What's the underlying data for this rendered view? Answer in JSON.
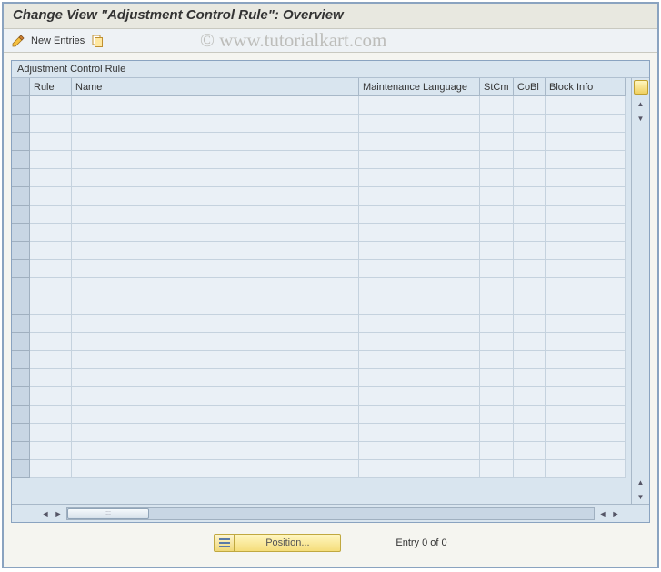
{
  "header": {
    "title": "Change View \"Adjustment Control Rule\": Overview"
  },
  "toolbar": {
    "new_entries_label": "New Entries"
  },
  "grid": {
    "title": "Adjustment Control Rule",
    "columns": {
      "rule": "Rule",
      "name": "Name",
      "lang": "Maintenance Language",
      "stcm": "StCm",
      "cobl": "CoBl",
      "block": "Block Info"
    },
    "rows": [
      {
        "rule": "",
        "name": "",
        "lang": "",
        "stcm": "",
        "cobl": "",
        "block": ""
      },
      {
        "rule": "",
        "name": "",
        "lang": "",
        "stcm": "",
        "cobl": "",
        "block": ""
      },
      {
        "rule": "",
        "name": "",
        "lang": "",
        "stcm": "",
        "cobl": "",
        "block": ""
      },
      {
        "rule": "",
        "name": "",
        "lang": "",
        "stcm": "",
        "cobl": "",
        "block": ""
      },
      {
        "rule": "",
        "name": "",
        "lang": "",
        "stcm": "",
        "cobl": "",
        "block": ""
      },
      {
        "rule": "",
        "name": "",
        "lang": "",
        "stcm": "",
        "cobl": "",
        "block": ""
      },
      {
        "rule": "",
        "name": "",
        "lang": "",
        "stcm": "",
        "cobl": "",
        "block": ""
      },
      {
        "rule": "",
        "name": "",
        "lang": "",
        "stcm": "",
        "cobl": "",
        "block": ""
      },
      {
        "rule": "",
        "name": "",
        "lang": "",
        "stcm": "",
        "cobl": "",
        "block": ""
      },
      {
        "rule": "",
        "name": "",
        "lang": "",
        "stcm": "",
        "cobl": "",
        "block": ""
      },
      {
        "rule": "",
        "name": "",
        "lang": "",
        "stcm": "",
        "cobl": "",
        "block": ""
      },
      {
        "rule": "",
        "name": "",
        "lang": "",
        "stcm": "",
        "cobl": "",
        "block": ""
      },
      {
        "rule": "",
        "name": "",
        "lang": "",
        "stcm": "",
        "cobl": "",
        "block": ""
      },
      {
        "rule": "",
        "name": "",
        "lang": "",
        "stcm": "",
        "cobl": "",
        "block": ""
      },
      {
        "rule": "",
        "name": "",
        "lang": "",
        "stcm": "",
        "cobl": "",
        "block": ""
      },
      {
        "rule": "",
        "name": "",
        "lang": "",
        "stcm": "",
        "cobl": "",
        "block": ""
      },
      {
        "rule": "",
        "name": "",
        "lang": "",
        "stcm": "",
        "cobl": "",
        "block": ""
      },
      {
        "rule": "",
        "name": "",
        "lang": "",
        "stcm": "",
        "cobl": "",
        "block": ""
      },
      {
        "rule": "",
        "name": "",
        "lang": "",
        "stcm": "",
        "cobl": "",
        "block": ""
      },
      {
        "rule": "",
        "name": "",
        "lang": "",
        "stcm": "",
        "cobl": "",
        "block": ""
      },
      {
        "rule": "",
        "name": "",
        "lang": "",
        "stcm": "",
        "cobl": "",
        "block": ""
      }
    ]
  },
  "footer": {
    "position_label": "Position...",
    "entry_text": "Entry 0 of 0"
  },
  "watermark": "© www.tutorialkart.com"
}
